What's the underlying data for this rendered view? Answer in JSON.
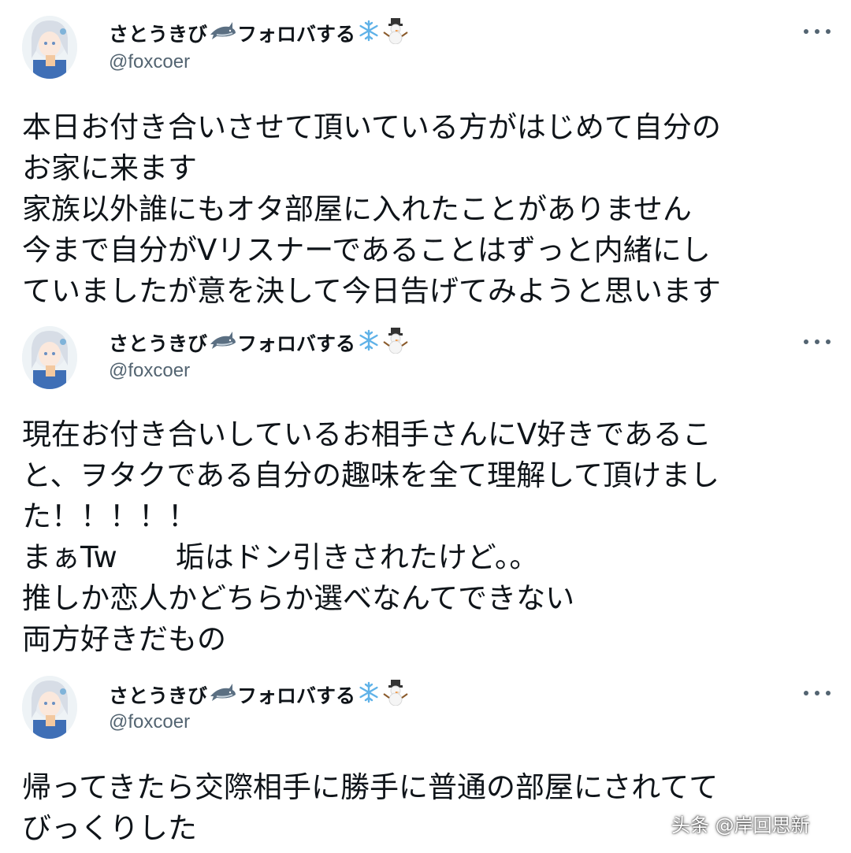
{
  "tweets": [
    {
      "display_name": "さとうきび",
      "display_name_suffix": "フォロバする",
      "handle": "@foxcoer",
      "text": "本日お付き合いさせて頂いている方がはじめて自分の\nお家に来ます\n家族以外誰にもオタ部屋に入れたことがありません\n今まで自分がVリスナーであることはずっと内緒にし\nていましたが意を決して今日告げてみようと思います"
    },
    {
      "display_name": "さとうきび",
      "display_name_suffix": "フォロバする",
      "handle": "@foxcoer",
      "text": "現在お付き合いしているお相手さんにV好きであるこ\nと、ヲタクである自分の趣味を全て理解して頂けまし\nた！！！！！\nまぁTw　　垢はドン引きされたけど。。\n推しか恋人かどちらか選べなんてできない\n両方好きだもの"
    },
    {
      "display_name": "さとうきび",
      "display_name_suffix": "フォロバする",
      "handle": "@foxcoer",
      "text": "帰ってきたら交際相手に勝手に普通の部屋にされてて\nびっくりした"
    }
  ],
  "icons": {
    "name_emoji_1": "shark-emoji-icon",
    "name_emoji_2": "snowflake-emoji-icon",
    "name_emoji_3": "snowman-emoji-icon",
    "more": "more-options-icon"
  },
  "watermark": "头条 @岸回思新",
  "colors": {
    "text": "#0f1419",
    "secondary": "#536471",
    "background": "#ffffff"
  }
}
